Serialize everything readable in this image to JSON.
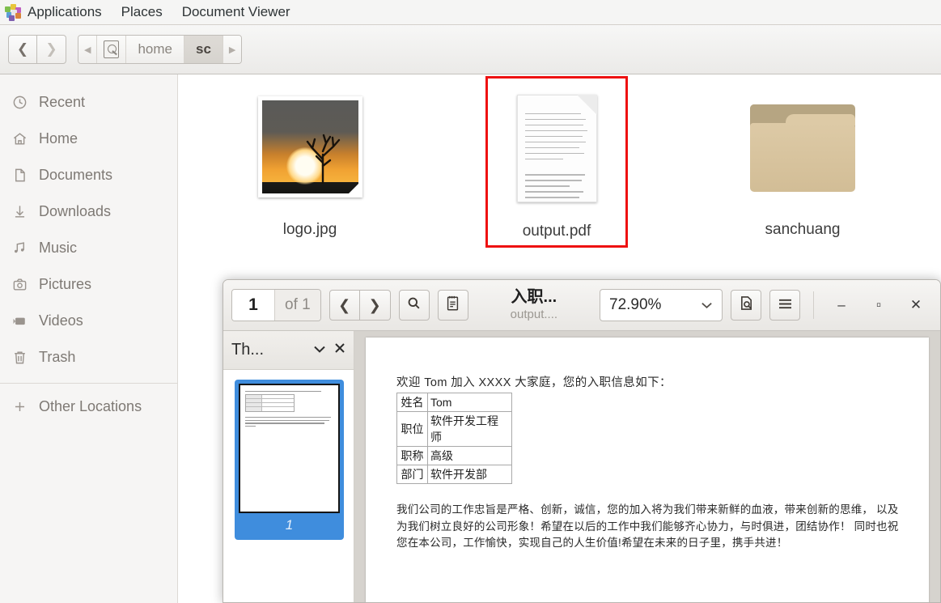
{
  "desktop_panel": {
    "logo_icon": "gnome-apps-icon",
    "items": [
      {
        "label": "Applications"
      },
      {
        "label": "Places"
      },
      {
        "label": "Document Viewer"
      }
    ]
  },
  "file_manager": {
    "nav": {
      "back_icon": "chevron-left-icon",
      "forward_icon": "chevron-right-icon"
    },
    "breadcrumb": {
      "prev_icon": "caret-left-icon",
      "drive_icon": "drive-icon",
      "next_icon": "caret-right-icon",
      "crumbs": [
        {
          "label": "home",
          "active": false
        },
        {
          "label": "sc",
          "active": true
        }
      ]
    },
    "sidebar": {
      "items": [
        {
          "label": "Recent",
          "icon": "clock-icon",
          "glyph": "◴"
        },
        {
          "label": "Home",
          "icon": "home-icon",
          "glyph": "⌂"
        },
        {
          "label": "Documents",
          "icon": "document-icon",
          "glyph": "❐"
        },
        {
          "label": "Downloads",
          "icon": "download-icon",
          "glyph": "↓"
        },
        {
          "label": "Music",
          "icon": "music-icon",
          "glyph": "♫"
        },
        {
          "label": "Pictures",
          "icon": "camera-icon",
          "glyph": "▣"
        },
        {
          "label": "Videos",
          "icon": "video-icon",
          "glyph": "▶"
        },
        {
          "label": "Trash",
          "icon": "trash-icon",
          "glyph": "⌧"
        }
      ],
      "other_locations": {
        "label": "Other Locations",
        "icon": "plus-icon",
        "glyph": "+"
      }
    },
    "files": [
      {
        "name": "logo.jpg",
        "icon": "image-file-icon",
        "selected": false
      },
      {
        "name": "output.pdf",
        "icon": "pdf-file-icon",
        "selected": true
      },
      {
        "name": "sanchuang",
        "icon": "folder-icon",
        "selected": false
      }
    ],
    "selection_color": "#ee1111"
  },
  "document_viewer": {
    "toolbar": {
      "page_current": "1",
      "page_total": "of 1",
      "prev_page_icon": "chevron-left-icon",
      "next_page_icon": "chevron-right-icon",
      "search_icon": "search-icon",
      "annotations_icon": "annotations-icon",
      "title": "入职...",
      "subtitle": "output....",
      "zoom_value": "72.90%",
      "zoom_chevron_icon": "chevron-down-icon",
      "fit_page_icon": "fit-page-icon",
      "menu_icon": "hamburger-menu-icon",
      "minimize_icon": "minimize-icon",
      "maximize_icon": "maximize-icon",
      "close_icon": "close-icon",
      "minimize_glyph": "–",
      "maximize_glyph": "▫",
      "close_glyph": "✕"
    },
    "sidepane": {
      "title": "Th...",
      "dropdown_icon": "chevron-down-icon",
      "close_icon": "close-icon",
      "thumbnail_page_number": "1"
    },
    "page": {
      "greeting": "欢迎 Tom 加入 XXXX 大家庭，您的入职信息如下：",
      "table": [
        {
          "key": "姓名",
          "value": "Tom"
        },
        {
          "key": "职位",
          "value": "软件开发工程师"
        },
        {
          "key": "职称",
          "value": "高级"
        },
        {
          "key": "部门",
          "value": "软件开发部"
        }
      ],
      "paragraph": "我们公司的工作忠旨是严格、创新，诚信，您的加入将为我们带来新鲜的血液，带来创新的思维， 以及为我们树立良好的公司形象！希望在以后的工作中我们能够齐心协力，与时俱进，团结协作！ 同时也祝您在本公司，工作愉快，实现自己的人生价值!希望在未来的日子里，携手共进！"
    },
    "thumbnail_selected_color": "#3f8ddd"
  }
}
